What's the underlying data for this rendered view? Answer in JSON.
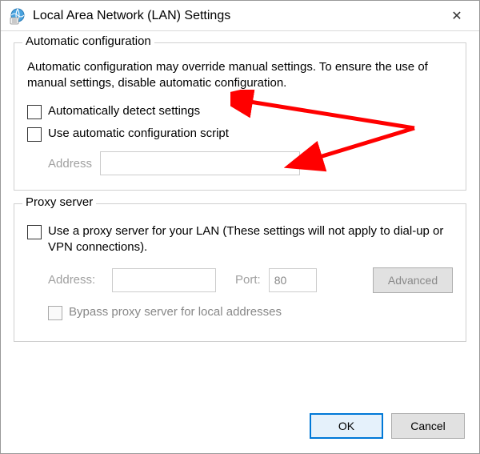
{
  "window": {
    "title": "Local Area Network (LAN) Settings",
    "icon": "globe-settings-icon",
    "close_glyph": "✕"
  },
  "auto": {
    "legend": "Automatic configuration",
    "description": "Automatic configuration may override manual settings.  To ensure the use of manual settings, disable automatic configuration.",
    "detect_label": "Automatically detect settings",
    "detect_checked": false,
    "script_label": "Use automatic configuration script",
    "script_checked": false,
    "address_label": "Address",
    "address_value": ""
  },
  "proxy": {
    "legend": "Proxy server",
    "use_label": "Use a proxy server for your LAN (These settings will not apply to dial-up or VPN connections).",
    "use_checked": false,
    "address_label": "Address:",
    "address_value": "",
    "port_label": "Port:",
    "port_value": "80",
    "advanced_label": "Advanced",
    "bypass_label": "Bypass proxy server for local addresses",
    "bypass_checked": false
  },
  "buttons": {
    "ok": "OK",
    "cancel": "Cancel"
  },
  "annotations": {
    "arrow1": "red-arrow",
    "arrow2": "red-arrow"
  }
}
